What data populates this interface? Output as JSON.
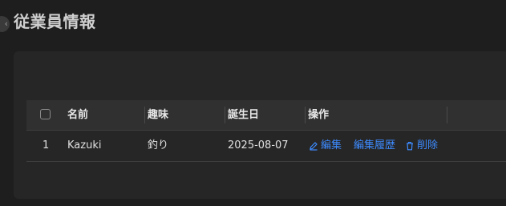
{
  "page": {
    "title": "従業員情報"
  },
  "sidebar": {
    "collapse_icon": "chevron-left-icon",
    "collapse_glyph": "‹"
  },
  "table": {
    "columns": [
      "名前",
      "趣味",
      "誕生日",
      "操作"
    ],
    "rows": [
      {
        "index": "1",
        "name": "Kazuki",
        "hobby": "釣り",
        "birthday": "2025-08-07",
        "actions": {
          "edit": "編集",
          "history": "編集履歴",
          "delete": "削除"
        }
      }
    ]
  },
  "colors": {
    "accent": "#3d8bff",
    "background": "#1e1e1e",
    "card": "#262626",
    "header": "#303030"
  }
}
